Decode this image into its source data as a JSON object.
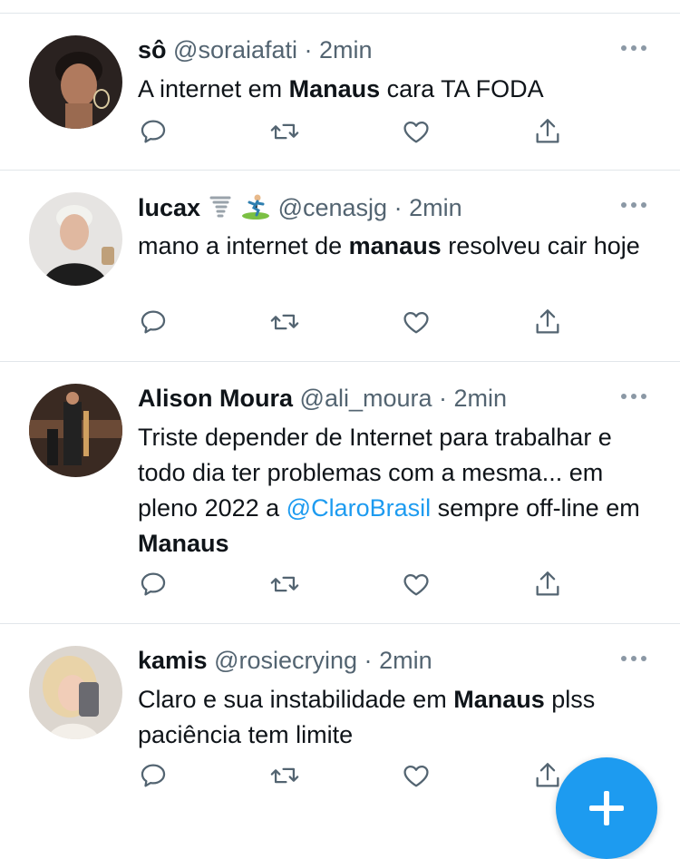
{
  "tweets": [
    {
      "name": "sô",
      "handle": "@soraiafati",
      "separator": "·",
      "time": "2min",
      "avatar_icon": "profile-photo-avatar",
      "text_parts": [
        "A internet em ",
        "Manaus",
        " cara TA FODA"
      ]
    },
    {
      "name": "lucax",
      "emojis": [
        "tornado-emoji",
        "surfer-emoji"
      ],
      "handle": "@cenasjg",
      "separator": "·",
      "time": "2min",
      "avatar_icon": "profile-photo-avatar",
      "text_parts": [
        "mano a internet de ",
        "manaus",
        " resolveu cair hoje"
      ]
    },
    {
      "name": "Alison Moura",
      "handle": "@ali_moura",
      "separator": "·",
      "time": "2min",
      "avatar_icon": "profile-photo-avatar",
      "text_parts": [
        "Triste depender de Internet para trabalhar e todo dia ter problemas com a mesma... em pleno 2022 a ",
        "@ClaroBrasil",
        " sempre off-line em ",
        "Manaus"
      ]
    },
    {
      "name": "kamis",
      "handle": "@rosiecrying",
      "separator": "·",
      "time": "2min",
      "avatar_icon": "profile-photo-avatar",
      "text_parts": [
        "Claro e sua instabilidade em ",
        "Manaus",
        " plss paciência tem limite"
      ]
    }
  ],
  "action_icons": [
    "reply-icon",
    "retweet-icon",
    "like-icon",
    "share-icon"
  ],
  "fab_icon": "compose-plus-icon",
  "colors": {
    "accent": "#1d9bf0",
    "secondary_text": "#536471",
    "primary_text": "#0f1419",
    "divider": "#e1e6ea"
  }
}
